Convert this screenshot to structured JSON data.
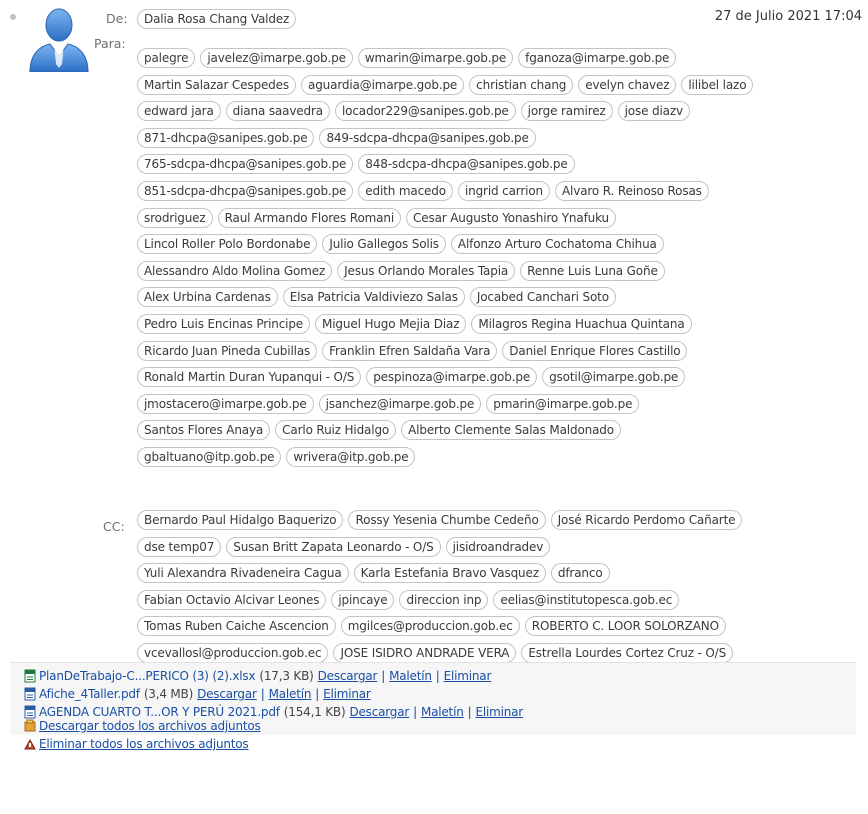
{
  "header": {
    "from_label": "De:",
    "to_label": "Para:",
    "cc_label": "CC:",
    "date": "27 de Julio 2021 17:04",
    "from": "Dalia Rosa Chang Valdez"
  },
  "to_rows": [
    [
      "palegre",
      "javelez@imarpe.gob.pe",
      "wmarin@imarpe.gob.pe",
      "fganoza@imarpe.gob.pe"
    ],
    [
      "Martin Salazar Cespedes",
      "aguardia@imarpe.gob.pe",
      "christian chang",
      "evelyn chavez",
      "lilibel lazo"
    ],
    [
      "edward jara",
      "diana saavedra",
      "locador229@sanipes.gob.pe",
      "jorge ramirez",
      "jose diazv"
    ],
    [
      "871-dhcpa@sanipes.gob.pe",
      "849-sdcpa-dhcpa@sanipes.gob.pe"
    ],
    [
      "765-sdcpa-dhcpa@sanipes.gob.pe",
      "848-sdcpa-dhcpa@sanipes.gob.pe"
    ],
    [
      "851-sdcpa-dhcpa@sanipes.gob.pe",
      "edith macedo",
      "ingrid carrion",
      "Alvaro R. Reinoso Rosas"
    ],
    [
      "srodriguez",
      "Raul Armando Flores Romani",
      "Cesar Augusto Yonashiro Ynafuku"
    ],
    [
      "Lincol Roller Polo Bordonabe",
      "Julio Gallegos Solis",
      "Alfonzo Arturo Cochatoma Chihua"
    ],
    [
      "Alessandro Aldo Molina Gomez",
      "Jesus Orlando Morales Tapia",
      "Renne Luis Luna Goñe"
    ],
    [
      "Alex Urbina Cardenas",
      "Elsa Patricia Valdiviezo Salas",
      "Jocabed Canchari Soto"
    ],
    [
      "Pedro Luis Encinas Principe",
      "Miguel Hugo Mejia Diaz",
      "Milagros Regina Huachua Quintana"
    ],
    [
      "Ricardo Juan Pineda Cubillas",
      "Franklin Efren Saldaña Vara",
      "Daniel Enrique Flores Castillo"
    ],
    [
      "Ronald Martin Duran Yupanqui - O/S",
      "pespinoza@imarpe.gob.pe",
      "gsotil@imarpe.gob.pe"
    ],
    [
      "jmostacero@imarpe.gob.pe",
      "jsanchez@imarpe.gob.pe",
      "pmarin@imarpe.gob.pe"
    ],
    [
      "Santos Flores Anaya",
      "Carlo Ruiz Hidalgo",
      "Alberto Clemente Salas Maldonado"
    ],
    [
      "gbaltuano@itp.gob.pe",
      "wrivera@itp.gob.pe"
    ]
  ],
  "cc_rows": [
    [
      "Bernardo Paul Hidalgo Baquerizo",
      "Rossy Yesenia Chumbe Cedeño",
      "José Ricardo Perdomo Cañarte"
    ],
    [
      "dse temp07",
      "Susan Britt Zapata Leonardo - O/S",
      "jisidroandradev"
    ],
    [
      "Yuli Alexandra Rivadeneira Cagua",
      "Karla Estefania Bravo Vasquez",
      "dfranco"
    ],
    [
      "Fabian Octavio Alcivar Leones",
      "jpincaye",
      "direccion inp",
      "eelias@institutopesca.gob.ec"
    ],
    [
      "Tomas Ruben Caiche Ascencion",
      "mgilces@produccion.gob.ec",
      "ROBERTO C. LOOR SOLORZANO"
    ],
    [
      "vcevallosl@produccion.gob.ec",
      "JOSE ISIDRO ANDRADE VERA",
      "Estrella Lourdes Cortez Cruz - O/S"
    ]
  ],
  "attachments": [
    {
      "name": "PlanDeTrabajo-C...PERICO (3) (2).xlsx",
      "size": "(17,3 KB)",
      "icon": "excel-file-icon",
      "color": "#1f7a3f"
    },
    {
      "name": "Afiche_4Taller.pdf",
      "size": "(3,4 MB)",
      "icon": "pdf-file-icon",
      "color": "#2b5ca8"
    },
    {
      "name": "AGENDA CUARTO T...OR Y PERÚ 2021.pdf",
      "size": "(154,1 KB)",
      "icon": "pdf-file-icon",
      "color": "#2b5ca8"
    }
  ],
  "attachment_actions": {
    "download": "Descargar",
    "briefcase": "Maletín",
    "delete": "Eliminar",
    "separator": "|"
  },
  "bulk_actions": {
    "download_all": "Descargar todos los archivos adjuntos",
    "delete_all": "Eliminar todos los archivos adjuntos"
  },
  "colors": {
    "link": "#1a4fa3",
    "avatar": "#3f86d8",
    "chip_border": "#c4c4c4"
  }
}
